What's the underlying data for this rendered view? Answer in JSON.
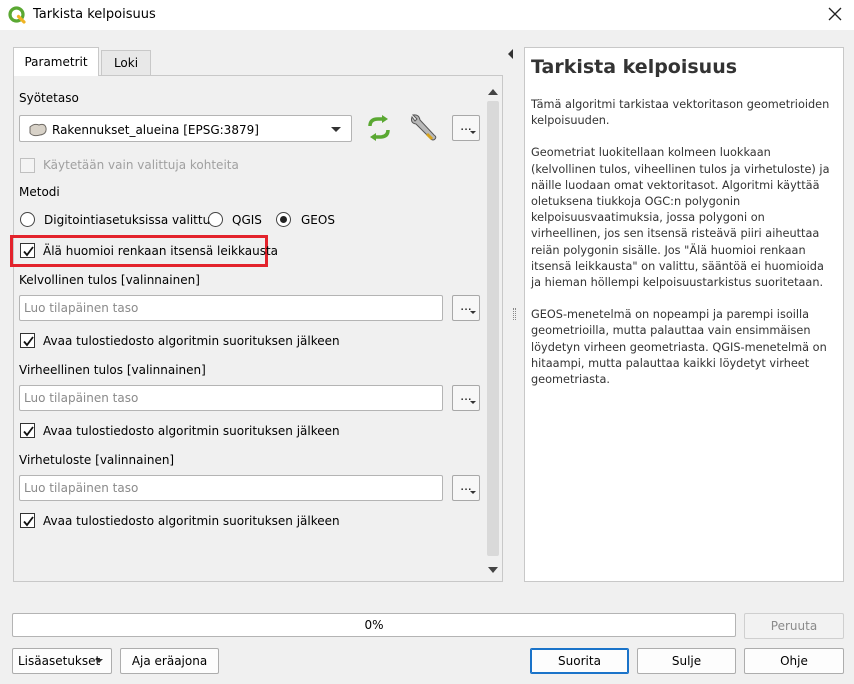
{
  "window": {
    "title": "Tarkista kelpoisuus"
  },
  "tabs": [
    {
      "label": "Parametrit",
      "active": true
    },
    {
      "label": "Loki",
      "active": false
    }
  ],
  "params": {
    "input_layer_label": "Syötetaso",
    "input_layer_value": "Rakennukset_alueina [EPSG:3879]",
    "selected_only_label": "Käytetään vain valittuja kohteita",
    "method_label": "Metodi",
    "method_options": [
      "Digitointiasetuksissa valittu",
      "QGIS",
      "GEOS"
    ],
    "method_selected": "GEOS",
    "ignore_ring_label": "Älä huomioi renkaan itsensä leikkausta",
    "valid_output_label": "Kelvollinen tulos [valinnainen]",
    "invalid_output_label": "Virheellinen tulos [valinnainen]",
    "error_output_label": "Virhetuloste [valinnainen]",
    "output_placeholder": "Luo tilapäinen taso",
    "open_output_label": "Avaa tulostiedosto algoritmin suorituksen jälkeen",
    "dots_label": "..."
  },
  "help": {
    "title": "Tarkista kelpoisuus",
    "paragraphs": [
      "Tämä algoritmi tarkistaa vektoritason geometrioiden kelpoisuuden.",
      "Geometriat luokitellaan kolmeen luokkaan (kelvollinen tulos, viheellinen tulos ja virhetuloste) ja näille luodaan omat vektoritasot. Algoritmi käyttää oletuksena tiukkoja OGC:n polygonin kelpoisuusvaatimuksia, jossa polygoni on virheellinen, jos sen itsensä risteävä piiri aiheuttaa reiän polygonin sisälle. Jos \"Älä huomioi renkaan itsensä leikkausta\" on valittu, sääntöä ei huomioida ja hieman höllempi kelpoisuustarkistus suoritetaan.",
      "GEOS-menetelmä on nopeampi ja parempi isoilla geometrioilla, mutta palauttaa vain ensimmäisen löydetyn virheen geometriasta. QGIS-menetelmä on hitaampi, mutta palauttaa kaikki löydetyt virheet geometriasta."
    ]
  },
  "progress": {
    "value": 0,
    "label": "0%"
  },
  "buttons": {
    "cancel": "Peruuta",
    "advanced": "Lisäasetukset",
    "batch": "Aja eräajona",
    "run": "Suorita",
    "close": "Sulje",
    "help": "Ohje"
  },
  "colors": {
    "highlight": "#e3232c",
    "refresh_icon": "#5aa832",
    "default_button_border": "#1a73c9"
  },
  "icons": [
    "qgis-logo-icon",
    "close-icon",
    "polygon-layer-icon",
    "refresh-icon",
    "wrench-icon",
    "check-icon"
  ]
}
